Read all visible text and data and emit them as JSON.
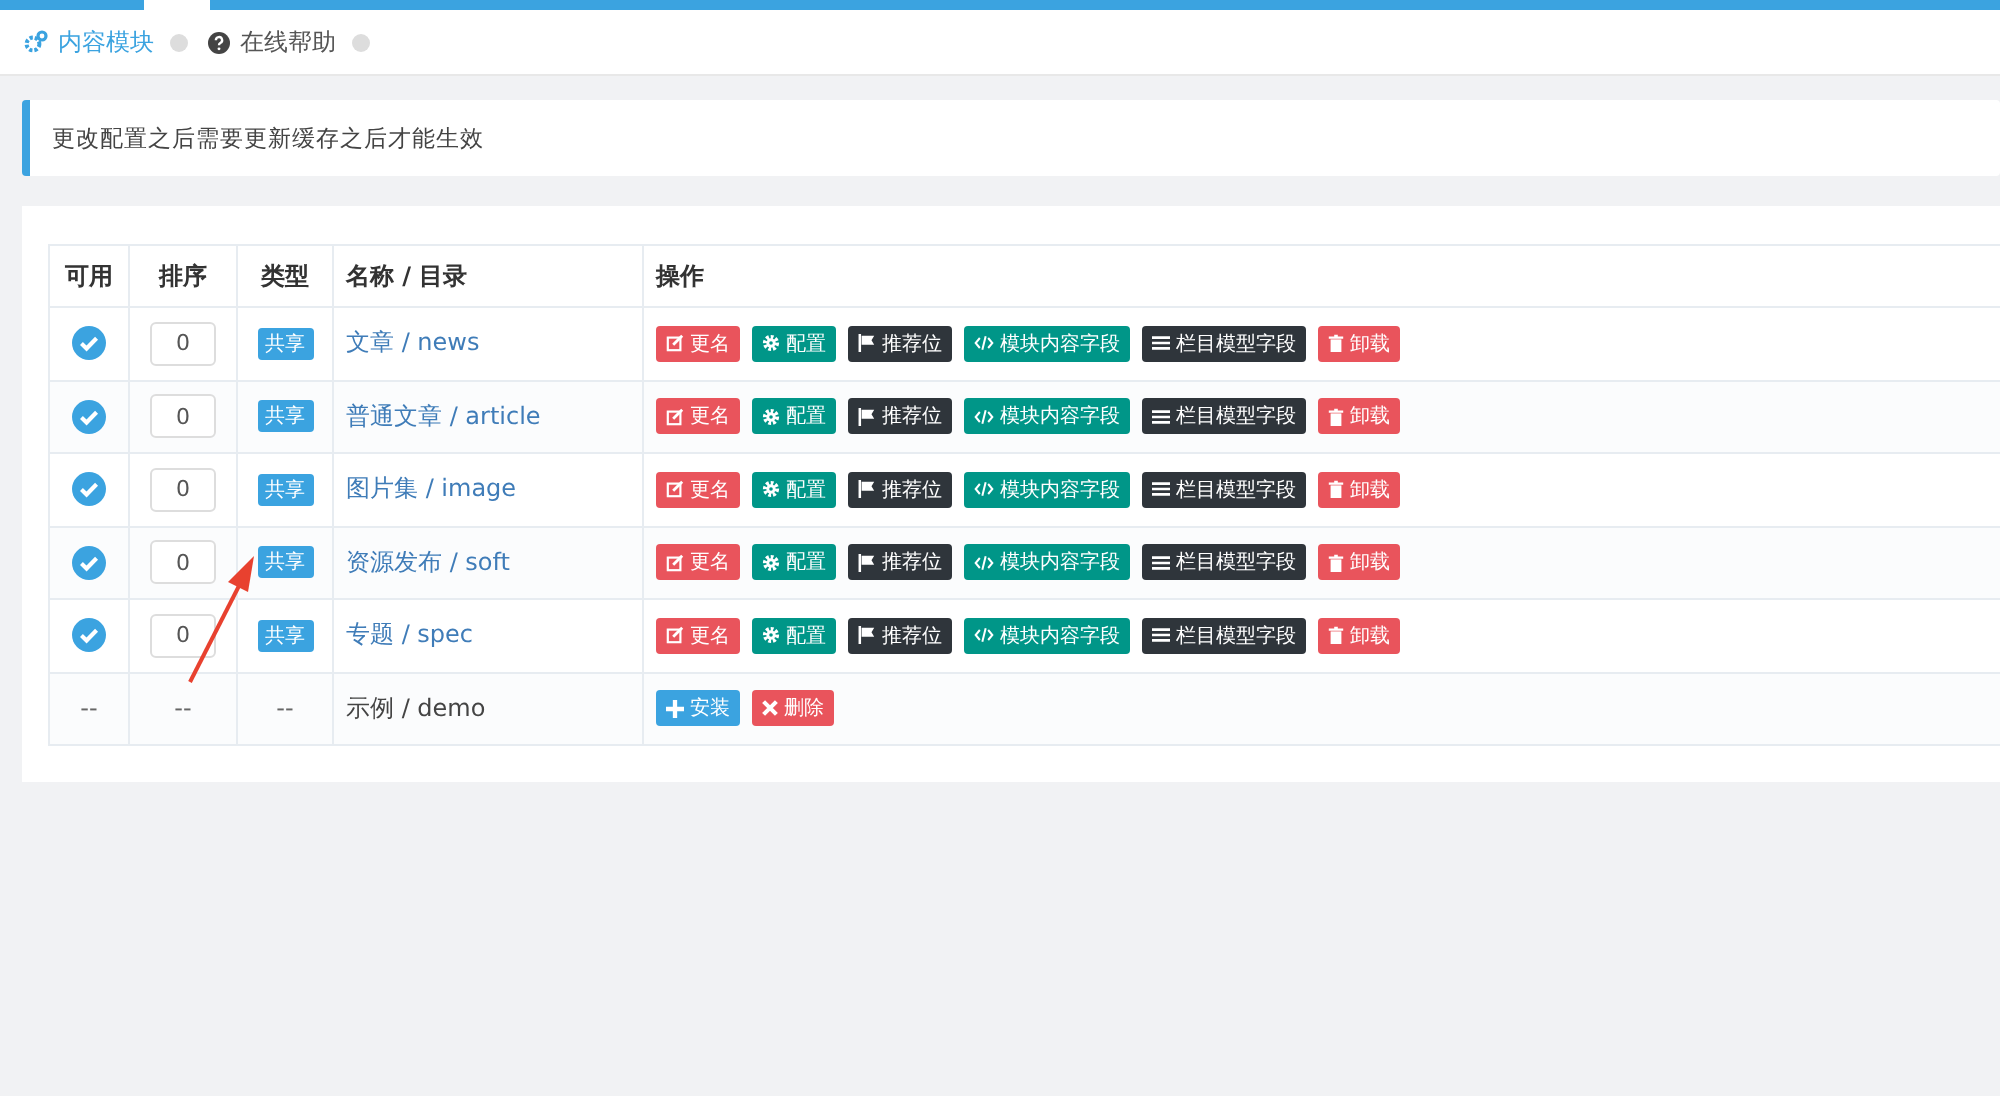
{
  "tabs": [
    {
      "label": "内容模块",
      "kind": "modules",
      "selected": true
    },
    {
      "label": "在线帮助",
      "kind": "help",
      "selected": false
    }
  ],
  "notice": "更改配置之后需要更新缓存之后才能生效",
  "table": {
    "columns": [
      "可用",
      "排序",
      "类型",
      "名称 / 目录",
      "操作"
    ],
    "rows": [
      {
        "kind": "installed",
        "enabled": true,
        "order": "0",
        "type": "共享",
        "name": "文章 / news",
        "actions": [
          {
            "kind": "rename",
            "label": "更名"
          },
          {
            "kind": "config",
            "label": "配置"
          },
          {
            "kind": "recommend",
            "label": "推荐位"
          },
          {
            "kind": "fields",
            "label": "模块内容字段"
          },
          {
            "kind": "category",
            "label": "栏目模型字段"
          },
          {
            "kind": "uninstall",
            "label": "卸载"
          }
        ]
      },
      {
        "kind": "installed",
        "enabled": true,
        "order": "0",
        "type": "共享",
        "name": "普通文章 / article",
        "actions": [
          {
            "kind": "rename",
            "label": "更名"
          },
          {
            "kind": "config",
            "label": "配置"
          },
          {
            "kind": "recommend",
            "label": "推荐位"
          },
          {
            "kind": "fields",
            "label": "模块内容字段"
          },
          {
            "kind": "category",
            "label": "栏目模型字段"
          },
          {
            "kind": "uninstall",
            "label": "卸载"
          }
        ]
      },
      {
        "kind": "installed",
        "enabled": true,
        "order": "0",
        "type": "共享",
        "name": "图片集 / image",
        "actions": [
          {
            "kind": "rename",
            "label": "更名"
          },
          {
            "kind": "config",
            "label": "配置"
          },
          {
            "kind": "recommend",
            "label": "推荐位"
          },
          {
            "kind": "fields",
            "label": "模块内容字段"
          },
          {
            "kind": "category",
            "label": "栏目模型字段"
          },
          {
            "kind": "uninstall",
            "label": "卸载"
          }
        ]
      },
      {
        "kind": "installed",
        "enabled": true,
        "order": "0",
        "type": "共享",
        "name": "资源发布 / soft",
        "actions": [
          {
            "kind": "rename",
            "label": "更名"
          },
          {
            "kind": "config",
            "label": "配置"
          },
          {
            "kind": "recommend",
            "label": "推荐位"
          },
          {
            "kind": "fields",
            "label": "模块内容字段"
          },
          {
            "kind": "category",
            "label": "栏目模型字段"
          },
          {
            "kind": "uninstall",
            "label": "卸载"
          }
        ]
      },
      {
        "kind": "installed",
        "enabled": true,
        "order": "0",
        "type": "共享",
        "name": "专题 / spec",
        "actions": [
          {
            "kind": "rename",
            "label": "更名"
          },
          {
            "kind": "config",
            "label": "配置"
          },
          {
            "kind": "recommend",
            "label": "推荐位"
          },
          {
            "kind": "fields",
            "label": "模块内容字段"
          },
          {
            "kind": "category",
            "label": "栏目模型字段"
          },
          {
            "kind": "uninstall",
            "label": "卸载"
          }
        ]
      },
      {
        "kind": "available",
        "enabled_text": "--",
        "order": "--",
        "type": "--",
        "name": "示例 / demo",
        "actions": [
          {
            "kind": "install",
            "label": "安装"
          },
          {
            "kind": "delete",
            "label": "删除"
          }
        ]
      }
    ]
  }
}
